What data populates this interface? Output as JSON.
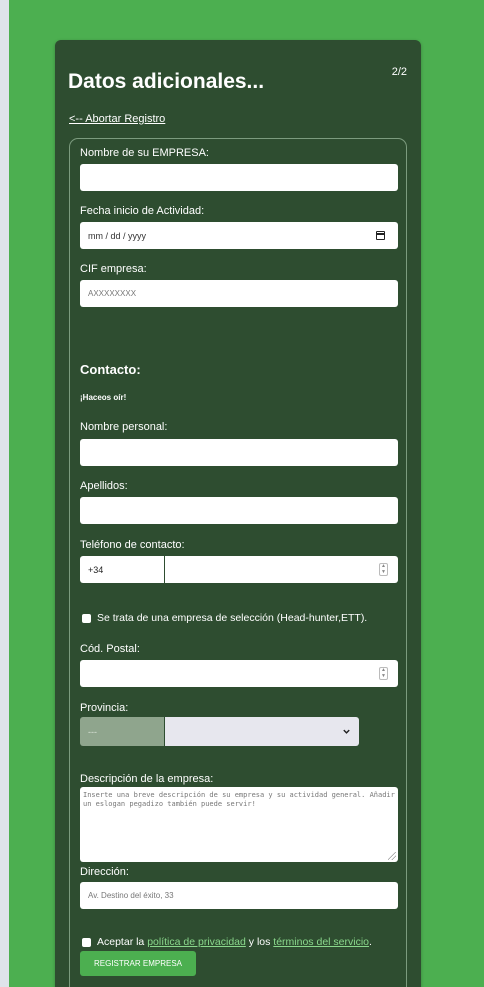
{
  "page": {
    "step": "2/2",
    "title": "Datos adicionales...",
    "abort_link": "<-- Abortar Registro"
  },
  "company": {
    "name_label": "Nombre de su EMPRESA:",
    "name_value": "",
    "start_date_label": "Fecha inicio de Actividad:",
    "start_date_placeholder": "mm / dd / yyyy",
    "cif_label": "CIF empresa:",
    "cif_placeholder": "AXXXXXXXX"
  },
  "contact": {
    "section_title": "Contacto:",
    "section_subtitle": "¡Haceos oír!",
    "first_name_label": "Nombre personal:",
    "last_name_label": "Apellidos:",
    "phone_label": "Teléfono de contacto:",
    "phone_prefix": "+34",
    "phone_number": "",
    "headhunter_checkbox": "Se trata de una empresa de selección (Head-hunter,ETT).",
    "postal_label": "Cód. Postal:",
    "province_label": "Provincia:",
    "province_code": "---",
    "province_selected": "",
    "description_label": "Descripción de la empresa:",
    "description_placeholder": "Inserte una breve descripción de su empresa y su actividad general. Añadir un eslogan pegadizo también puede servir!",
    "address_label": "Dirección:",
    "address_placeholder": "Av. Destino del éxito, 33"
  },
  "terms": {
    "prefix": "Aceptar la",
    "privacy_link": "política de privacidad",
    "middle": "y los",
    "terms_link": "términos del servicio",
    "suffix": "."
  },
  "submit": {
    "label": "REGISTRAR EMPRESA"
  },
  "colors": {
    "page_background": "#4caf50",
    "card_background": "#2e4d30",
    "button": "#4caf50",
    "link": "#8ad88c"
  },
  "icons": [
    "calendar-icon",
    "spinner-icon",
    "chevron-down-icon",
    "resize-handle-icon"
  ]
}
